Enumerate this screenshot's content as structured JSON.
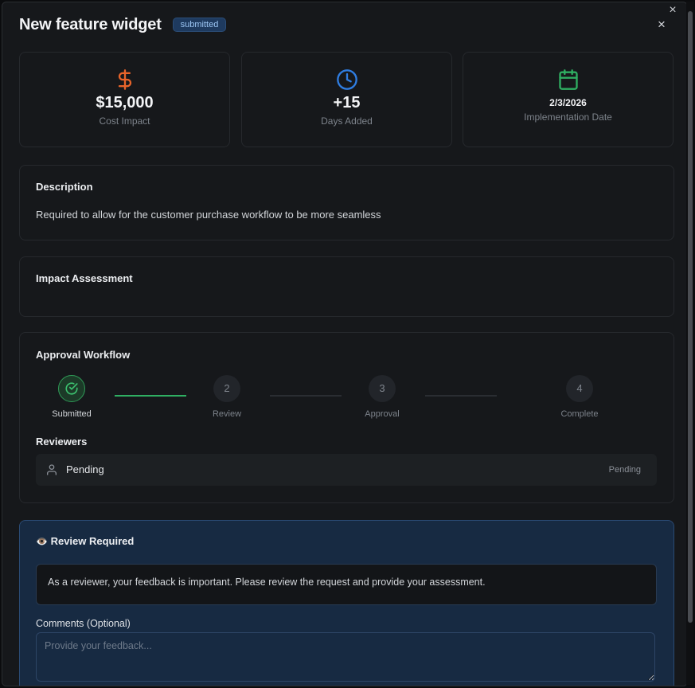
{
  "modal": {
    "title": "New feature widget",
    "status_badge": "submitted",
    "close_label": "×",
    "outer_close_label": "×"
  },
  "stats": [
    {
      "icon": "dollar-icon",
      "color": "#e8642a",
      "value": "$15,000",
      "label": "Cost Impact"
    },
    {
      "icon": "clock-icon",
      "color": "#2f7de1",
      "value": "+15",
      "label": "Days Added"
    },
    {
      "icon": "calendar-icon",
      "color": "#2fae62",
      "value": "2/3/2026",
      "label": "Implementation Date"
    }
  ],
  "description": {
    "title": "Description",
    "text": "Required to allow for the customer purchase workflow to be more seamless"
  },
  "impact": {
    "title": "Impact Assessment"
  },
  "workflow": {
    "title": "Approval Workflow",
    "steps": [
      {
        "number": "",
        "label": "Submitted",
        "done": true
      },
      {
        "number": "2",
        "label": "Review",
        "done": false
      },
      {
        "number": "3",
        "label": "Approval",
        "done": false
      },
      {
        "number": "4",
        "label": "Complete",
        "done": false
      }
    ],
    "reviewers_title": "Reviewers",
    "reviewers": [
      {
        "name": "Pending",
        "status": "Pending"
      }
    ]
  },
  "review": {
    "title": "Review Required",
    "emoji": "👁️",
    "info": "As a reviewer, your feedback is important. Please review the request and provide your assessment.",
    "comments_label": "Comments (Optional)",
    "comments_placeholder": "Provide your feedback..."
  },
  "colors": {
    "accent_green": "#2fae62",
    "accent_blue": "#2f7de1",
    "accent_orange": "#e8642a"
  }
}
